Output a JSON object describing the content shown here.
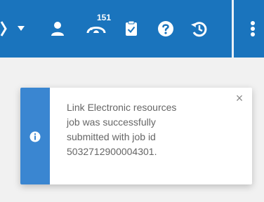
{
  "toolbar": {
    "background_color": "#1a74bd",
    "icons": [
      "chevron-right-icon",
      "caret-down-icon",
      "user-icon",
      "notification-icon",
      "clipboard-check-icon",
      "help-icon",
      "history-icon",
      "more-vertical-icon"
    ],
    "notification_badge": "151"
  },
  "toast": {
    "accent_color": "#3a86d1",
    "icon": "info-icon",
    "close_icon": "close-icon",
    "close_label": "×",
    "message_lines": [
      "Link Electronic resources",
      "job was successfully",
      "submitted with job id",
      "5032712900004301."
    ]
  }
}
